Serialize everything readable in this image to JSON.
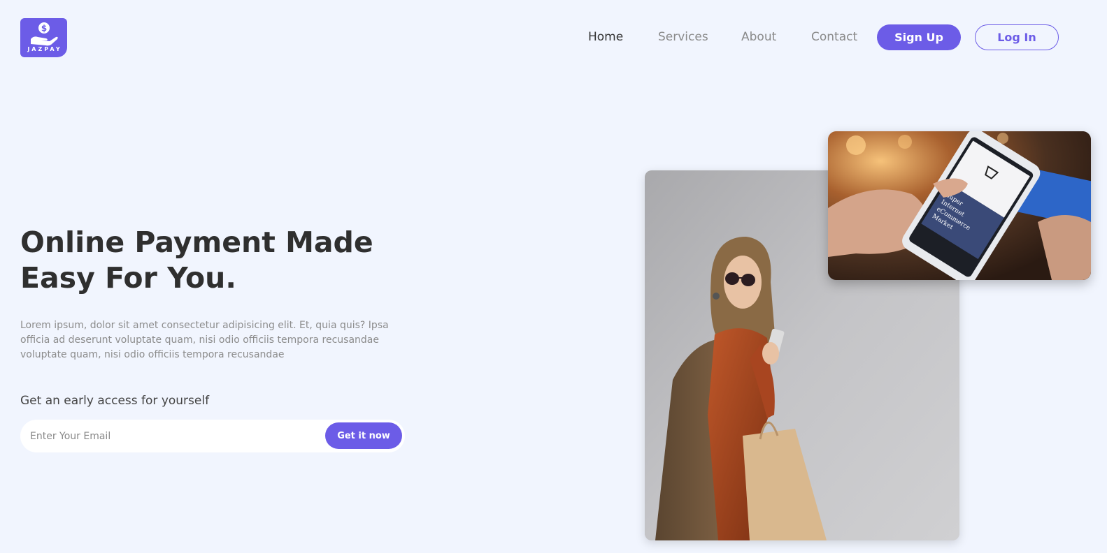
{
  "brand": {
    "name": "JAZPAY",
    "accent": "#6c5ce7",
    "logo_icon": "hand-coin-icon"
  },
  "nav": {
    "links": [
      {
        "label": "Home",
        "active": true
      },
      {
        "label": "Services",
        "active": false
      },
      {
        "label": "About",
        "active": false
      },
      {
        "label": "Contact",
        "active": false
      }
    ],
    "signup_label": "Sign Up",
    "login_label": "Log In"
  },
  "hero": {
    "title_line1": "Online Payment Made",
    "title_line2": "Easy For You.",
    "description": "Lorem ipsum, dolor sit amet consectetur adipisicing elit. Et, quia quis? Ipsa officia ad deserunt voluptate quam, nisi odio officiis tempora recusandae voluptate quam, nisi odio officiis tempora recusandae",
    "access_label": "Get an early access for yourself",
    "email_placeholder": "Enter Your Email",
    "cta_label": "Get it now"
  },
  "images": {
    "woman": "woman-shopping-photo",
    "phone": "phone-payment-photo",
    "phone_screen_text": "Super Internet eCommerce Market"
  }
}
